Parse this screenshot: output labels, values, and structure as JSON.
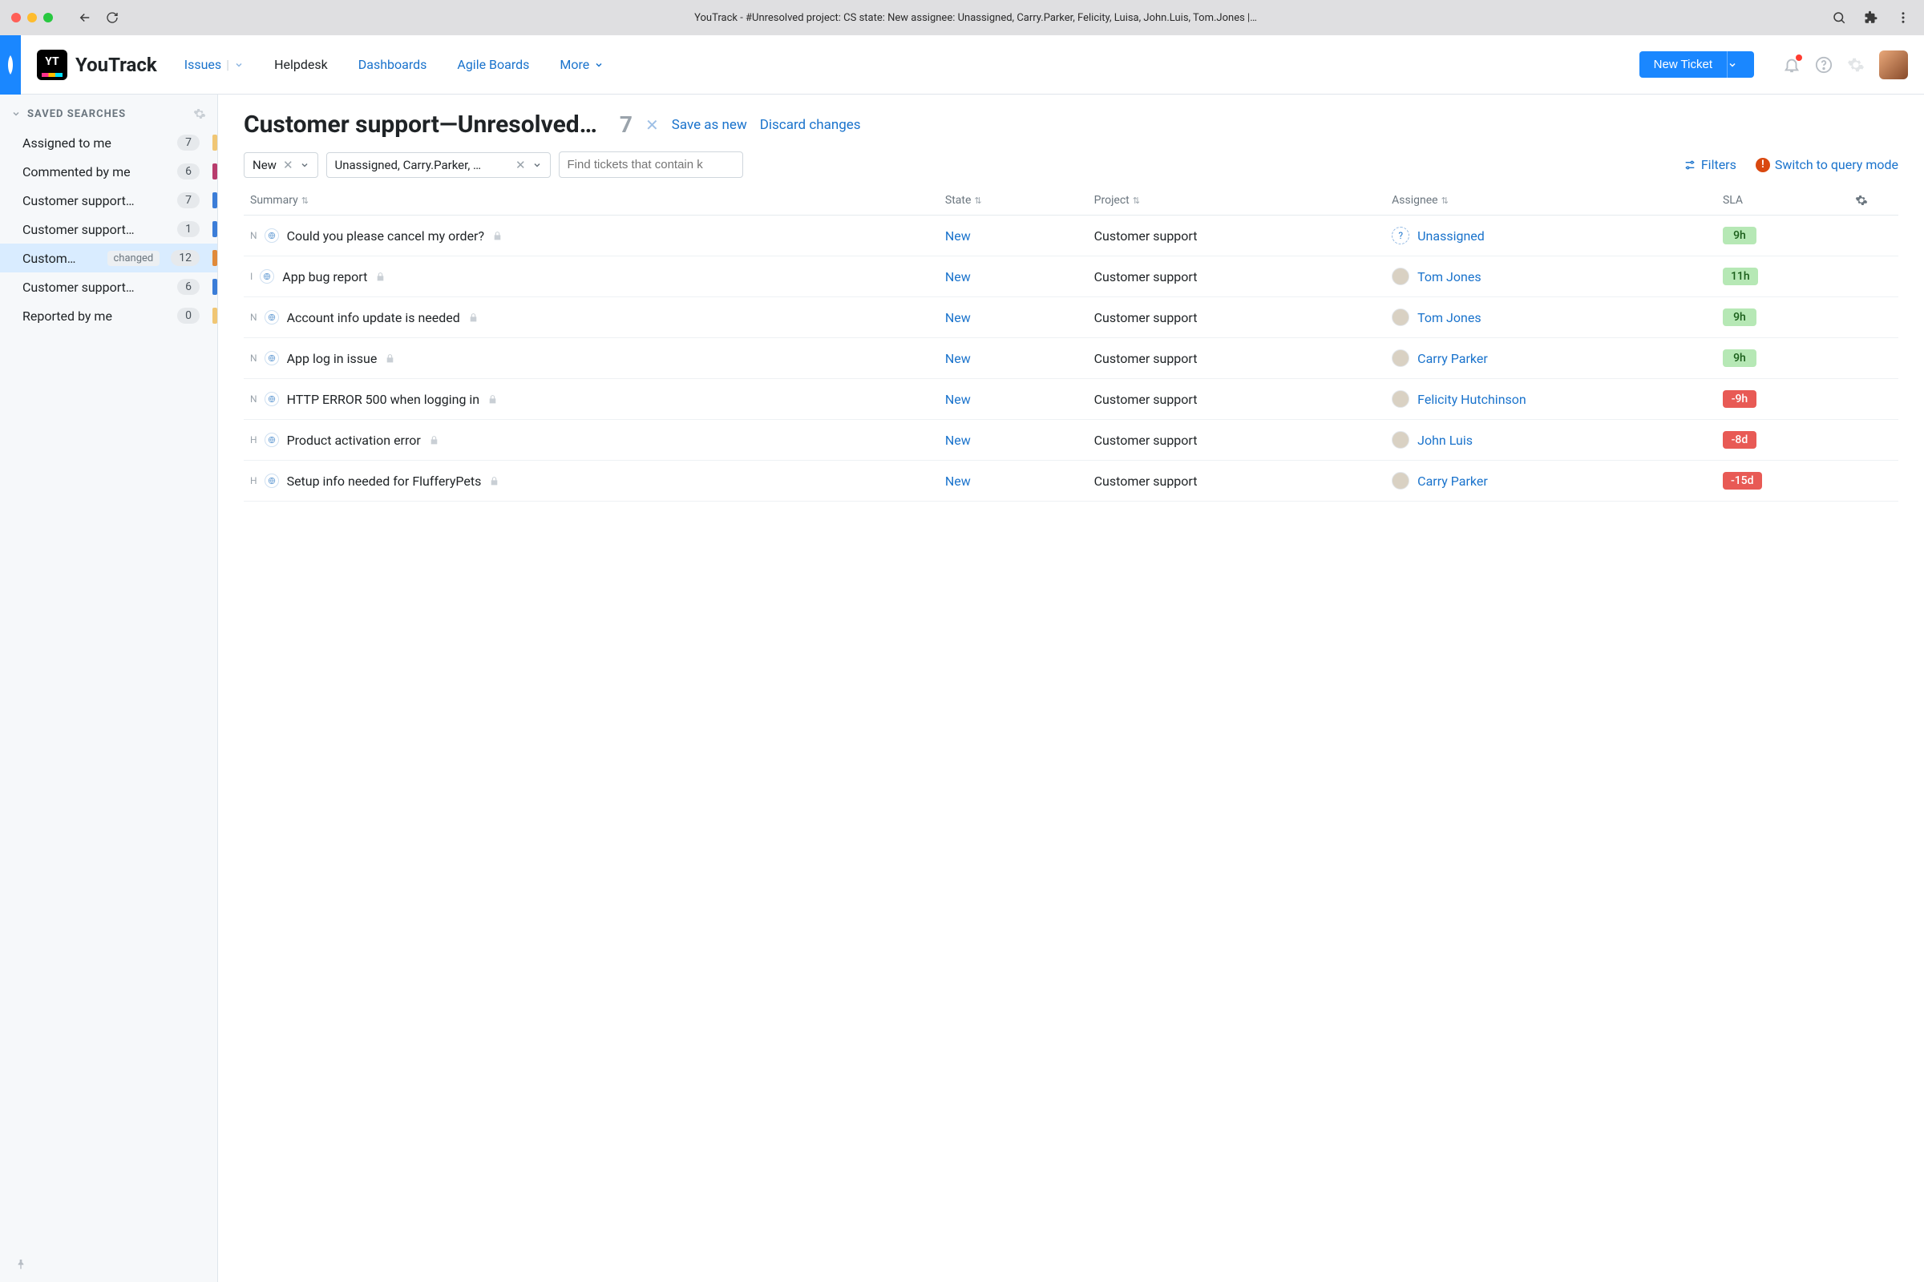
{
  "chrome": {
    "title": "YouTrack - #Unresolved project: CS state: New assignee: Unassigned, Carry.Parker, Felicity, Luisa, John.Luis, Tom.Jones |…"
  },
  "brand": {
    "name": "YouTrack",
    "logo_text": "YT"
  },
  "nav": {
    "issues": "Issues",
    "helpdesk": "Helpdesk",
    "dashboards": "Dashboards",
    "agile_boards": "Agile Boards",
    "more": "More"
  },
  "new_ticket": "New Ticket",
  "sidebar": {
    "header": "SAVED SEARCHES",
    "items": [
      {
        "label": "Assigned to me",
        "count": "7",
        "color": "#f0c674"
      },
      {
        "label": "Commented by me",
        "count": "6",
        "color": "#b83c6d"
      },
      {
        "label": "Customer support…",
        "count": "7",
        "color": "#3b7dd8"
      },
      {
        "label": "Customer support…",
        "count": "1",
        "color": "#3b7dd8"
      },
      {
        "label": "Custom…",
        "count": "12",
        "color": "#e08a3a",
        "changed": "changed",
        "selected": true
      },
      {
        "label": "Customer support…",
        "count": "6",
        "color": "#3b7dd8"
      },
      {
        "label": "Reported by me",
        "count": "0",
        "color": "#f0c674"
      }
    ]
  },
  "page": {
    "title": "Customer support—Unresolved…",
    "count": "7",
    "save_as_new": "Save as new",
    "discard": "Discard changes"
  },
  "filters": {
    "state_pill": "New",
    "assignee_pill": "Unassigned, Carry.Parker, …",
    "search_placeholder": "Find tickets that contain k",
    "filters_label": "Filters",
    "switch_label": "Switch to query mode"
  },
  "columns": {
    "summary": "Summary",
    "state": "State",
    "project": "Project",
    "assignee": "Assignee",
    "sla": "SLA"
  },
  "rows": [
    {
      "prio": "N",
      "summary": "Could you please cancel my order?",
      "state": "New",
      "project": "Customer support",
      "assignee": "Unassigned",
      "assignee_unassigned": true,
      "sla": "9h",
      "sla_color": "green"
    },
    {
      "prio": "I",
      "summary": "App bug report",
      "state": "New",
      "project": "Customer support",
      "assignee": "Tom Jones",
      "sla": "11h",
      "sla_color": "green"
    },
    {
      "prio": "N",
      "summary": "Account info update is needed",
      "state": "New",
      "project": "Customer support",
      "assignee": "Tom Jones",
      "sla": "9h",
      "sla_color": "green"
    },
    {
      "prio": "N",
      "summary": "App log in issue",
      "state": "New",
      "project": "Customer support",
      "assignee": "Carry Parker",
      "sla": "9h",
      "sla_color": "green"
    },
    {
      "prio": "N",
      "summary": "HTTP ERROR 500 when logging in",
      "state": "New",
      "project": "Customer support",
      "assignee": "Felicity Hutchinson",
      "sla": "-9h",
      "sla_color": "red"
    },
    {
      "prio": "H",
      "summary": "Product activation error",
      "state": "New",
      "project": "Customer support",
      "assignee": "John Luis",
      "sla": "-8d",
      "sla_color": "red"
    },
    {
      "prio": "H",
      "summary": "Setup info needed for FlufferyPets",
      "state": "New",
      "project": "Customer support",
      "assignee": "Carry Parker",
      "sla": "-15d",
      "sla_color": "red"
    }
  ]
}
